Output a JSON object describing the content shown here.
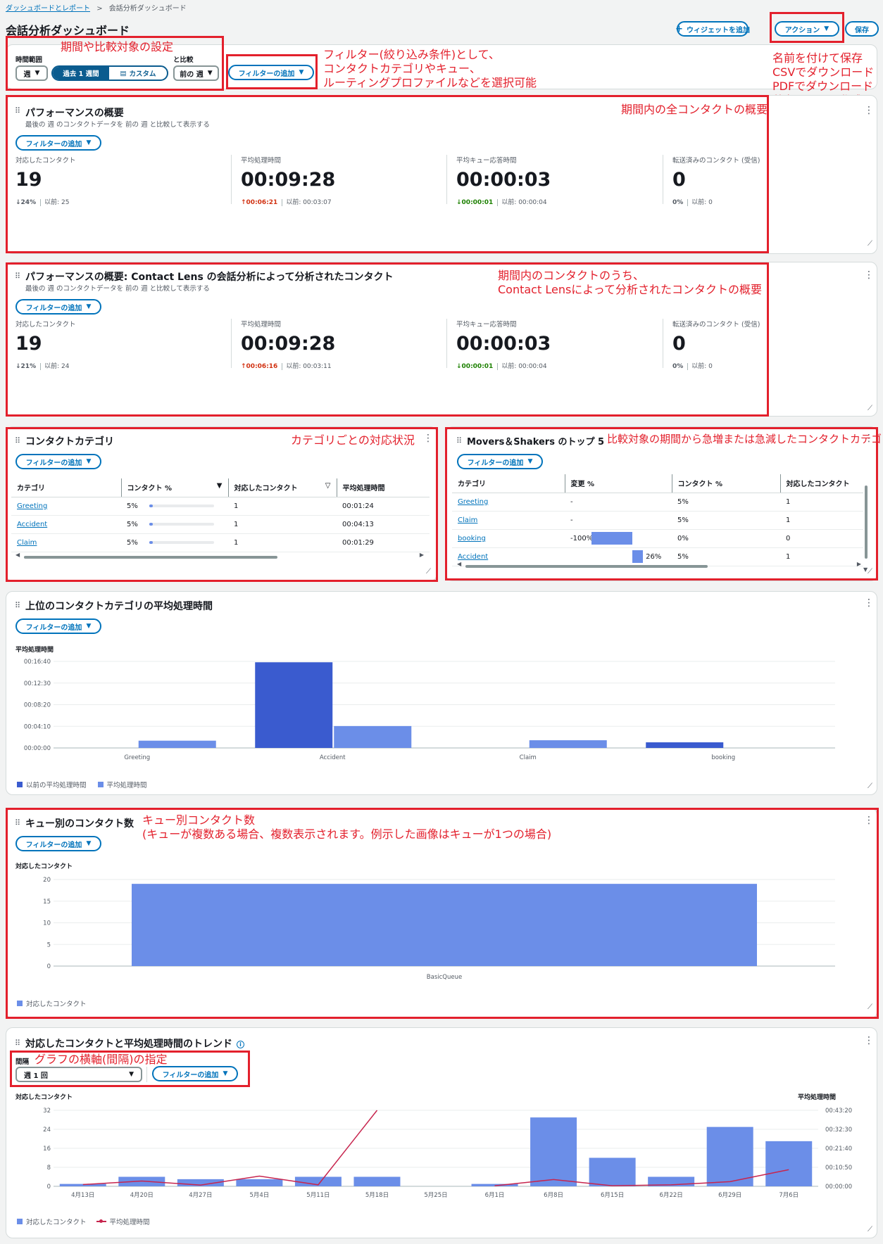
{
  "breadcrumb": {
    "parent": "ダッシュボードとレポート",
    "sep": ">",
    "current": "会話分析ダッシュボード"
  },
  "page_title": "会話分析ダッシュボード",
  "header_buttons": {
    "add_widget": "ウィジェットを追加",
    "actions": "アクション",
    "save": "保存"
  },
  "settings": {
    "time_range_label": "時間範囲",
    "unit": "週",
    "tab_last_week": "過去 1 週間",
    "tab_custom": "カスタム",
    "compare_label": "と比較",
    "compare_value": "前の 週",
    "filter_button": "フィルターの追加"
  },
  "filter_label": "フィルターの追加",
  "annotations": {
    "period": "期間や比較対象の設定",
    "filter": "フィルター(絞り込み条件)として、\nコンタクトカテゴリやキュー、\nルーティングプロファイルなどを選択可能",
    "actions": "名前を付けて保存\nCSVでダウンロード\nPDFでダウンロード\n共有リンクの作成",
    "perf1": "期間内の全コンタクトの概要",
    "perf2": "期間内のコンタクトのうち、\nContact Lensによって分析されたコンタクトの概要",
    "category": "カテゴリごとの対応状況",
    "movers": "比較対象の期間から急増または急減したコンタクトカテゴリ",
    "queue": "キュー別コンタクト数\n(キューが複数ある場合、複数表示されます。例示した画像はキューが1つの場合)",
    "interval": "グラフの横軸(間隔)の指定"
  },
  "perf1": {
    "title": "パフォーマンスの概要",
    "subtitle": "最後の 週 のコンタクトデータを 前の 週 と比較して表示する",
    "metrics": [
      {
        "label": "対応したコンタクト",
        "value": "19",
        "delta": "↓24%",
        "delta_color": "#545b64",
        "prev": "以前: 25"
      },
      {
        "label": "平均処理時間",
        "value": "00:09:28",
        "delta": "↑00:06:21",
        "delta_color": "#d13212",
        "prev": "以前: 00:03:07"
      },
      {
        "label": "平均キュー応答時間",
        "value": "00:00:03",
        "delta": "↓00:00:01",
        "delta_color": "#1d8102",
        "prev": "以前: 00:00:04"
      },
      {
        "label": "転送済みのコンタクト (受信)",
        "value": "0",
        "delta": "0%",
        "delta_color": "#545b64",
        "prev": "以前: 0"
      }
    ]
  },
  "perf2": {
    "title": "パフォーマンスの概要: Contact Lens の会話分析によって分析されたコンタクト",
    "subtitle": "最後の 週 のコンタクトデータを 前の 週 と比較して表示する",
    "metrics": [
      {
        "label": "対応したコンタクト",
        "value": "19",
        "delta": "↓21%",
        "delta_color": "#545b64",
        "prev": "以前: 24"
      },
      {
        "label": "平均処理時間",
        "value": "00:09:28",
        "delta": "↑00:06:16",
        "delta_color": "#d13212",
        "prev": "以前: 00:03:11"
      },
      {
        "label": "平均キュー応答時間",
        "value": "00:00:03",
        "delta": "↓00:00:01",
        "delta_color": "#1d8102",
        "prev": "以前: 00:00:04"
      },
      {
        "label": "転送済みのコンタクト (受信)",
        "value": "0",
        "delta": "0%",
        "delta_color": "#545b64",
        "prev": "以前: 0"
      }
    ]
  },
  "category_widget": {
    "title": "コンタクトカテゴリ",
    "columns": [
      "カテゴリ",
      "コンタクト %",
      "対応したコンタクト",
      "平均処理時間"
    ],
    "rows": [
      {
        "name": "Greeting",
        "pct": "5%",
        "pct_value": 5,
        "contacts": "1",
        "aht": "00:01:24"
      },
      {
        "name": "Accident",
        "pct": "5%",
        "pct_value": 5,
        "contacts": "1",
        "aht": "00:04:13"
      },
      {
        "name": "Claim",
        "pct": "5%",
        "pct_value": 5,
        "contacts": "1",
        "aht": "00:01:29"
      }
    ]
  },
  "movers_widget": {
    "title": "Movers＆Shakers のトップ 5",
    "columns": [
      "カテゴリ",
      "変更 %",
      "コンタクト %",
      "対応したコンタクト"
    ],
    "rows": [
      {
        "name": "Greeting",
        "change": "-",
        "change_value": null,
        "pct": "5%",
        "contacts": "1"
      },
      {
        "name": "Claim",
        "change": "-",
        "change_value": null,
        "pct": "5%",
        "contacts": "1"
      },
      {
        "name": "booking",
        "change": "-100%",
        "change_value": -100,
        "pct": "0%",
        "contacts": "0"
      },
      {
        "name": "Accident",
        "change": "26%",
        "change_value": 26,
        "pct": "5%",
        "contacts": "1"
      }
    ]
  },
  "aht_widget": {
    "title": "上位のコンタクトカテゴリの平均処理時間",
    "chart_data": {
      "type": "bar",
      "ylabel": "平均処理時間",
      "categories": [
        "Greeting",
        "Accident",
        "Claim",
        "booking"
      ],
      "yticks": [
        "00:00:00",
        "00:04:10",
        "00:08:20",
        "00:12:30",
        "00:16:40"
      ],
      "ylim_seconds": [
        0,
        1000
      ],
      "series": [
        {
          "name": "以前の平均処理時間",
          "color": "#3a5bcf",
          "values_seconds": [
            0,
            990,
            0,
            65
          ]
        },
        {
          "name": "平均処理時間",
          "color": "#6b8ee8",
          "values_seconds": [
            84,
            253,
            89,
            0
          ]
        }
      ]
    }
  },
  "queue_widget": {
    "title": "キュー別のコンタクト数",
    "chart_data": {
      "type": "bar",
      "ylabel": "対応したコンタクト",
      "categories": [
        "BasicQueue"
      ],
      "yticks": [
        "0",
        "5",
        "10",
        "15",
        "20"
      ],
      "ylim": [
        0,
        20
      ],
      "series": [
        {
          "name": "対応したコンタクト",
          "color": "#6b8ee8",
          "values": [
            19
          ]
        }
      ]
    }
  },
  "trend_widget": {
    "title": "対応したコンタクトと平均処理時間のトレンド",
    "interval_label": "間隔",
    "interval_value": "週 1 回",
    "chart_data": {
      "type": "bar+line",
      "ylabel_left": "対応したコンタクト",
      "ylabel_right": "平均処理時間",
      "categories": [
        "4月13日",
        "4月20日",
        "4月27日",
        "5月4日",
        "5月11日",
        "5月18日",
        "5月25日",
        "6月1日",
        "6月8日",
        "6月15日",
        "6月22日",
        "6月29日",
        "7月6日"
      ],
      "yticks_left": [
        "0",
        "8",
        "16",
        "24",
        "32"
      ],
      "yticks_right": [
        "00:00:00",
        "00:10:50",
        "00:21:40",
        "00:32:30",
        "00:43:20"
      ],
      "ylim_left": [
        0,
        32
      ],
      "ylim_right_seconds": [
        0,
        2600
      ],
      "series": [
        {
          "name": "対応したコンタクト",
          "type": "bar",
          "color": "#6b8ee8",
          "values": [
            1,
            4,
            3,
            3,
            4,
            4,
            0,
            1,
            29,
            12,
            4,
            25,
            19
          ]
        },
        {
          "name": "平均処理時間",
          "type": "line",
          "color": "#c7254e",
          "values_seconds": [
            60,
            180,
            40,
            350,
            50,
            2600,
            null,
            20,
            230,
            20,
            50,
            160,
            568
          ]
        }
      ]
    }
  }
}
